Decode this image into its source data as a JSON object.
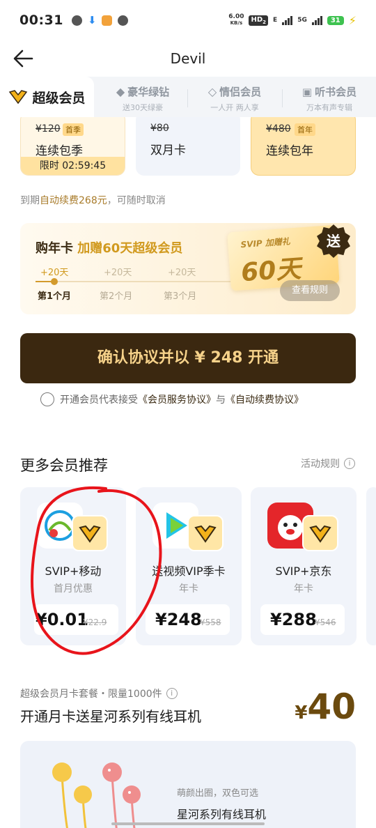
{
  "status_bar": {
    "time": "00:31",
    "net_speed": "6.00",
    "net_unit": "KB/s",
    "hd": "HD",
    "hd_sub": "2",
    "e_label": "E",
    "g5": "5G",
    "battery": "31"
  },
  "header": {
    "title": "Devil"
  },
  "tabs": [
    {
      "label": "超级会员",
      "sub": ""
    },
    {
      "label": "豪华绿钻",
      "sub": "送30天绿豪"
    },
    {
      "label": "情侣会员",
      "sub": "一人开 两人享"
    },
    {
      "label": "听书会员",
      "sub": "万本有声专辑"
    }
  ],
  "price_cards": [
    {
      "orig_price": "¥120",
      "tag": "首季",
      "name": "连续包季",
      "countdown": "限时 02:59:45"
    },
    {
      "orig_price": "¥80",
      "tag": "",
      "name": "双月卡"
    },
    {
      "orig_price": "¥480",
      "tag": "首年",
      "name": "连续包年"
    }
  ],
  "autorenew": {
    "prefix": "到期",
    "highlight": "自动续费268元",
    "suffix": "，可随时取消"
  },
  "promo": {
    "headline_pre": "购年卡 ",
    "headline_hl": "加赠60天超级会员",
    "steps": [
      {
        "amount": "+20天",
        "label": "第1个月"
      },
      {
        "amount": "+20天",
        "label": "第2个月"
      },
      {
        "amount": "+20天",
        "label": "第3个月"
      }
    ],
    "gift_title": "SVIP 加赠礼",
    "gift_days": "60天",
    "badge": "送",
    "rules_button": "查看规则"
  },
  "cta": {
    "label": "确认协议并以 ¥ 248 开通"
  },
  "agreement": {
    "pre": "开通会员代表接受",
    "link1": "《会员服务协议》",
    "mid": "与",
    "link2": "《自动续费协议》"
  },
  "more": {
    "title": "更多会员推荐",
    "rules": "活动规则",
    "cards": [
      {
        "name": "SVIP+移动",
        "sub": "首月优惠",
        "price": "¥0.01",
        "orig": "¥22.9"
      },
      {
        "name": "送视频VIP季卡",
        "sub": "年卡",
        "price": "¥248",
        "orig": "¥558"
      },
      {
        "name": "SVIP+京东",
        "sub": "年卡",
        "price": "¥288",
        "orig": "¥546"
      }
    ]
  },
  "bundle": {
    "sub": "超级会员月卡套餐・限量1000件",
    "title": "开通月卡送星河系列有线耳机",
    "price_currency": "¥",
    "price": "40",
    "product_desc": "萌颜出圈，双色可选",
    "product_name": "星河系列有线耳机"
  },
  "colors": {
    "accent_gold": "#d19a1f",
    "cta_bg": "#3b2810",
    "cta_text": "#f6d28a",
    "annotation_red": "#e8141b"
  }
}
